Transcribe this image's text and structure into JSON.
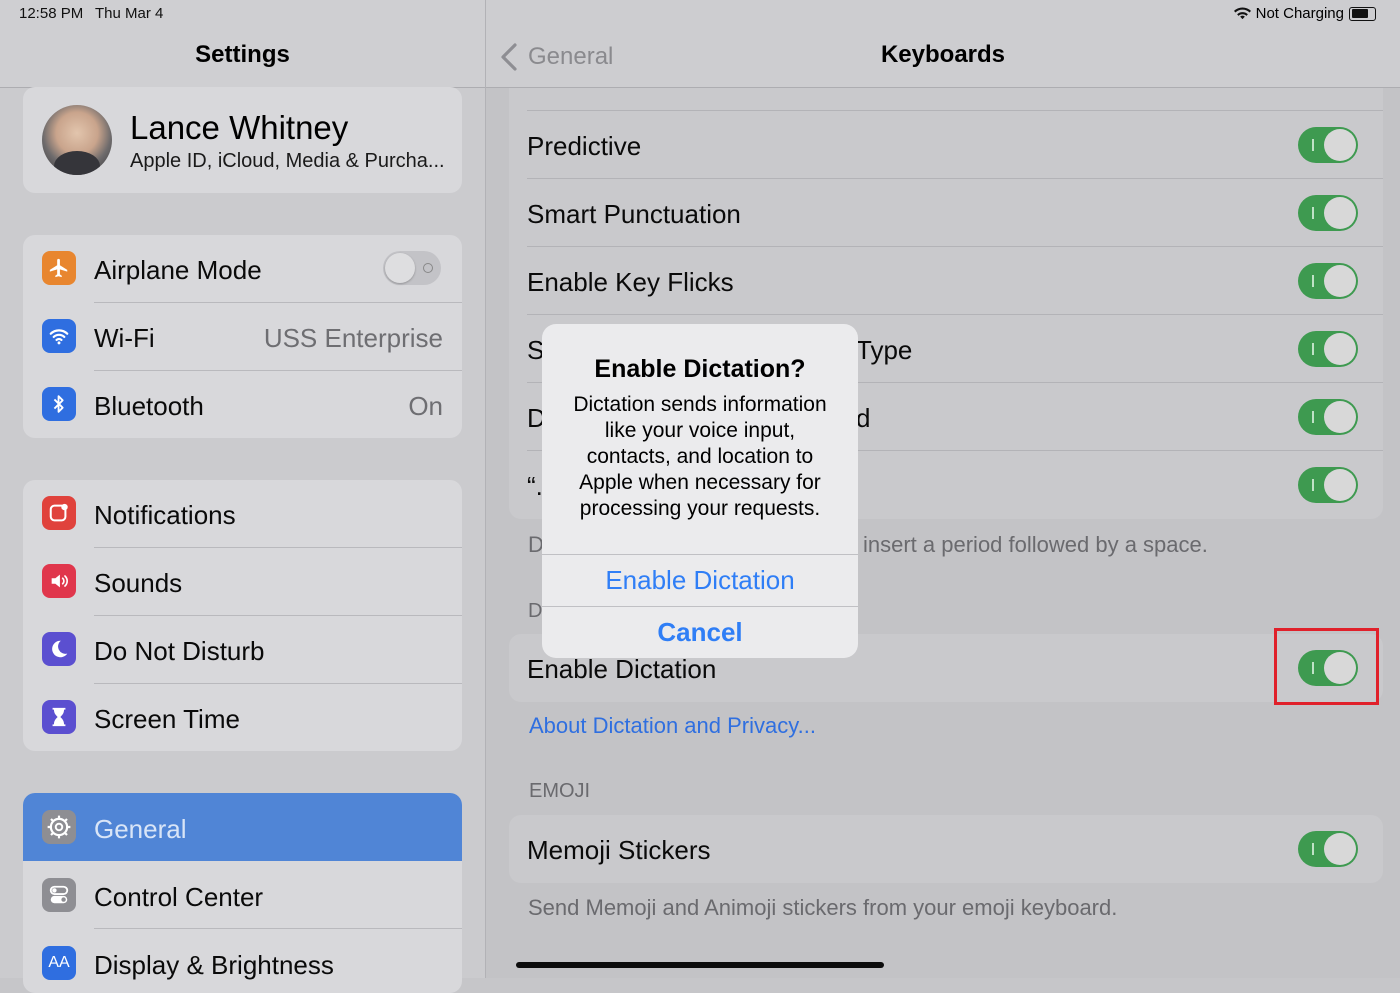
{
  "status_bar": {
    "time": "12:58 PM",
    "date": "Thu Mar 4",
    "battery_text": "Not Charging"
  },
  "sidebar": {
    "title": "Settings",
    "profile": {
      "name": "Lance Whitney",
      "subtitle": "Apple ID, iCloud, Media & Purcha..."
    },
    "group1": [
      {
        "label": "Airplane Mode",
        "icon": "airplane-icon",
        "color": "#e8862f",
        "toggle": false
      },
      {
        "label": "Wi-Fi",
        "value": "USS Enterprise",
        "icon": "wifi-icon",
        "color": "#2f6ee0"
      },
      {
        "label": "Bluetooth",
        "value": "On",
        "icon": "bluetooth-icon",
        "color": "#2f6ee0"
      }
    ],
    "group2": [
      {
        "label": "Notifications",
        "icon": "notifications-icon",
        "color": "#e0423c"
      },
      {
        "label": "Sounds",
        "icon": "sounds-icon",
        "color": "#e0364c"
      },
      {
        "label": "Do Not Disturb",
        "icon": "moon-icon",
        "color": "#5b4fd0"
      },
      {
        "label": "Screen Time",
        "icon": "hourglass-icon",
        "color": "#5b4fd0"
      }
    ],
    "group3": [
      {
        "label": "General",
        "icon": "gear-icon",
        "color": "#8e8e93",
        "selected": true
      },
      {
        "label": "Control Center",
        "icon": "control-center-icon",
        "color": "#8e8e93"
      },
      {
        "label": "Display & Brightness",
        "icon": "display-icon",
        "color": "#2f6ee0",
        "icon_text": "AA"
      }
    ],
    "selected_color": "#5085d6"
  },
  "detail": {
    "back_label": "General",
    "title": "Keyboards",
    "toggles": [
      {
        "label": "Predictive",
        "on": true
      },
      {
        "label": "Smart Punctuation",
        "on": true
      },
      {
        "label": "Enable Key Flicks",
        "on": true
      },
      {
        "label_left": "S",
        "label_right": "Type",
        "on": true
      },
      {
        "label_left": "D",
        "label_right": "d",
        "on": true
      },
      {
        "label_left": "“.",
        "on": true
      }
    ],
    "period_footer_left": "D",
    "period_footer_right": "insert a period followed by a space.",
    "dictation_header_partial": "D",
    "enable_dictation_label": "Enable Dictation",
    "about_dictation_link": "About Dictation and Privacy...",
    "emoji_header": "EMOJI",
    "memoji_label": "Memoji Stickers",
    "memoji_footer": "Send Memoji and Animoji stickers from your emoji keyboard.",
    "toggle_on_color": "#3e9a50",
    "highlight_color": "#e0202a"
  },
  "alert": {
    "title": "Enable Dictation?",
    "message": "Dictation sends information like your voice input, contacts, and location to Apple when necessary for processing your requests.",
    "confirm_label": "Enable Dictation",
    "cancel_label": "Cancel",
    "button_color": "#2f7ef6"
  }
}
